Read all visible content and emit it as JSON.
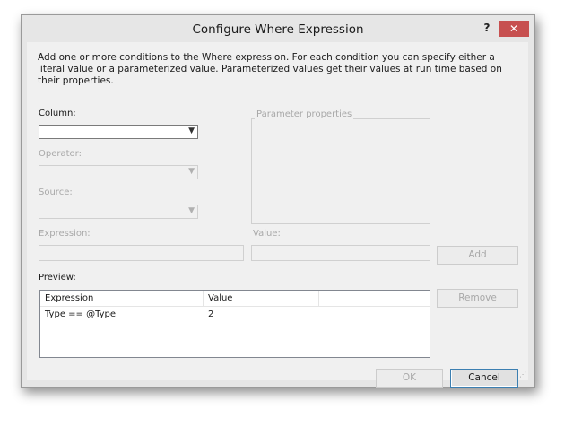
{
  "window": {
    "title": "Configure Where Expression",
    "help_label": "?",
    "close_label": "✕"
  },
  "description": "Add one or more conditions to the Where expression. For each condition you can specify either a literal value or a parameterized value. Parameterized values get their values at run time based on their properties.",
  "fields": {
    "column_label": "Column:",
    "operator_label": "Operator:",
    "source_label": "Source:",
    "expression_label": "Expression:",
    "value_label": "Value:",
    "parameter_group_label": "Parameter properties",
    "preview_label": "Preview:"
  },
  "preview": {
    "columns": [
      "Expression",
      "Value"
    ],
    "rows": [
      {
        "expression": "Type == @Type",
        "value": "2"
      }
    ]
  },
  "buttons": {
    "add": "Add",
    "remove": "Remove",
    "ok": "OK",
    "cancel": "Cancel"
  },
  "icons": {
    "dropdown": "chevron-down-icon",
    "resize": "resize-grip-icon"
  }
}
